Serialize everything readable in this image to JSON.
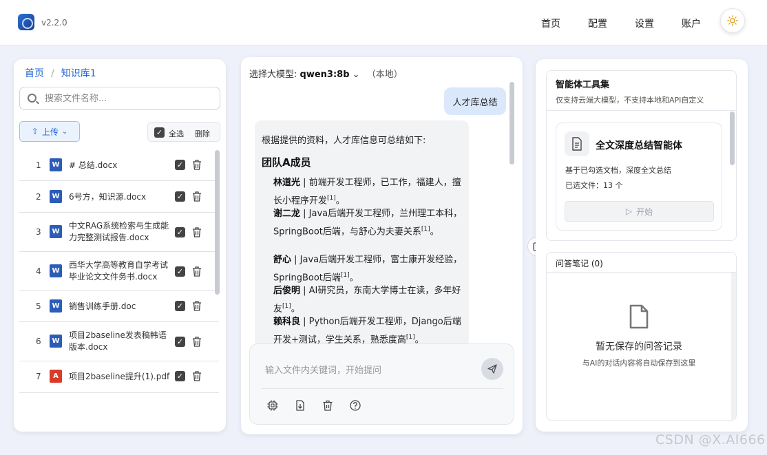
{
  "header": {
    "version": "v2.2.0",
    "nav": [
      {
        "label": "首页"
      },
      {
        "label": "配置"
      },
      {
        "label": "设置"
      },
      {
        "label": "账户"
      }
    ],
    "theme_icon": "sun-icon"
  },
  "left_panel": {
    "breadcrumb": [
      "首页",
      "/",
      "知识库1"
    ],
    "search_placeholder": "搜索文件名称...",
    "upload_label": "上传",
    "select_all_label": "全选",
    "delete_label": "删除",
    "files": [
      {
        "index": "1",
        "name": "# 总结.docx",
        "type": "doc",
        "checked": true
      },
      {
        "index": "2",
        "name": "6号方，知识源.docx",
        "type": "doc",
        "checked": true
      },
      {
        "index": "3",
        "name": "中文RAG系统检索与生成能力完整测试报告.docx",
        "type": "doc",
        "checked": true
      },
      {
        "index": "4",
        "name": "西华大学高等教育自学考试毕业论文文件务书.docx",
        "type": "doc",
        "checked": true
      },
      {
        "index": "5",
        "name": "销售训练手册.doc",
        "type": "doc",
        "checked": true
      },
      {
        "index": "6",
        "name": "项目2baseline发表稿韩语版本.docx",
        "type": "doc",
        "checked": true
      },
      {
        "index": "7",
        "name": "项目2baseline提升(1).pdf",
        "type": "pdf",
        "checked": true
      }
    ]
  },
  "chat": {
    "model_label": "选择大模型:",
    "model_name": "qwen3:8b",
    "model_location": "（本地）",
    "user_message": "人才库总结",
    "answer_intro": "根据提供的资料，人才库信息可总结如下:",
    "answer_heading": "团队A成员",
    "people": [
      {
        "name": "林道光",
        "desc": " | 前端开发工程师，已工作，福建人，擅长小程序开发",
        "ref": "[1]"
      },
      {
        "name": "谢二龙",
        "desc": " | Java后端开发工程师，兰州理工本科，SpringBoot后端，与舒心为夫妻关系",
        "ref": "[1]"
      },
      {
        "name": "舒心",
        "desc": " | Java后端开发工程师，富士康开发经验，SpringBoot后端",
        "ref": "[1]"
      },
      {
        "name": "后俊明",
        "desc": " | AI研究员，东南大学博士在读，多年好友",
        "ref": "[1]"
      },
      {
        "name": "赖科良",
        "desc": " | Python后端开发工程师，Django后端开发+测试，学生关系，熟悉度高",
        "ref": "[1]"
      }
    ],
    "end_mark": "。",
    "input_placeholder": "输入文件内关键词，开始提问"
  },
  "right_panel": {
    "tools_title": "智能体工具集",
    "tools_subtitle": "仅支持云端大模型，不支持本地和API自定义",
    "agent_title": "全文深度总结智能体",
    "agent_desc": "基于已勾选文档，深度全文总结",
    "agent_count": "已选文件：13 个",
    "start_label": "开始",
    "notes_title": "问答笔记 (0)",
    "notes_empty": "暂无保存的问答记录",
    "notes_hint": "与AI的对话内容将自动保存到这里"
  },
  "watermark": "CSDN @X.AI666"
}
